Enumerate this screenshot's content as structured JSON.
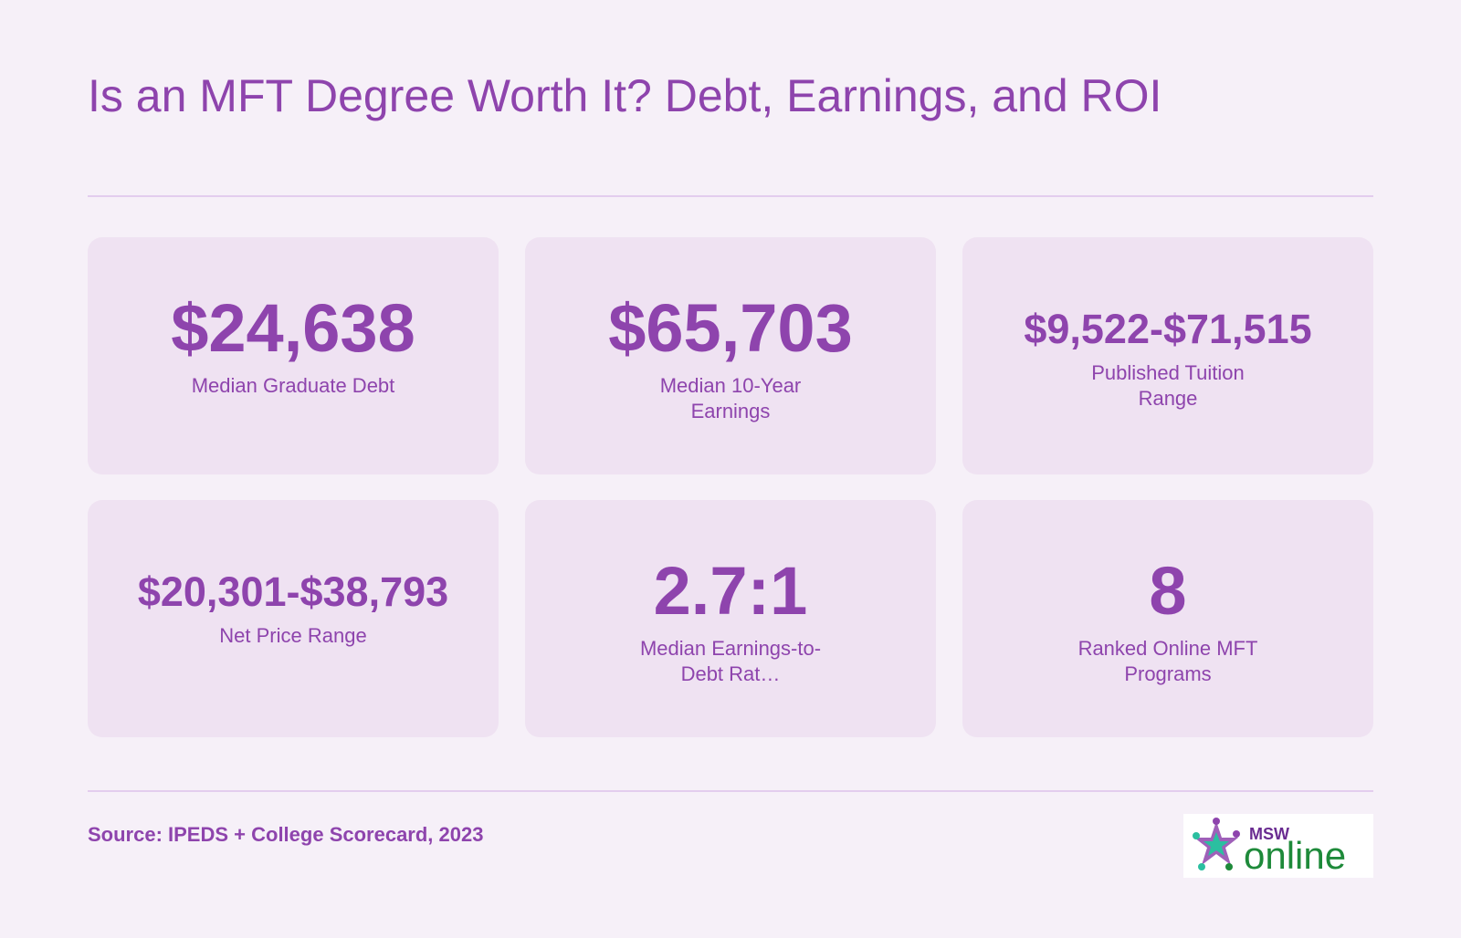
{
  "header": {
    "title": "Is an MFT Degree Worth It? Debt, Earnings, and ROI"
  },
  "stats": [
    {
      "value": "$24,638",
      "label": "Median Graduate Debt"
    },
    {
      "value": "$65,703",
      "label": "Median 10-Year Earnings"
    },
    {
      "value": "$9,522-$71,515",
      "label": "Published Tuition Range"
    },
    {
      "value": "$20,301-$38,793",
      "label": "Net Price Range"
    },
    {
      "value": "2.7:1",
      "label": "Median Earnings-to-Debt Rat…"
    },
    {
      "value": "8",
      "label": "Ranked Online MFT Programs"
    }
  ],
  "footer": {
    "source": "Source: IPEDS + College Scorecard, 2023",
    "logo_text_top": "MSW",
    "logo_text_main": "online"
  },
  "colors": {
    "background": "#f6f0f8",
    "card": "#efe2f2",
    "accent_purple": "#8e44ad",
    "divider": "#e3cdee",
    "logo_green": "#1e8a3a",
    "logo_teal": "#2bbfa0"
  }
}
